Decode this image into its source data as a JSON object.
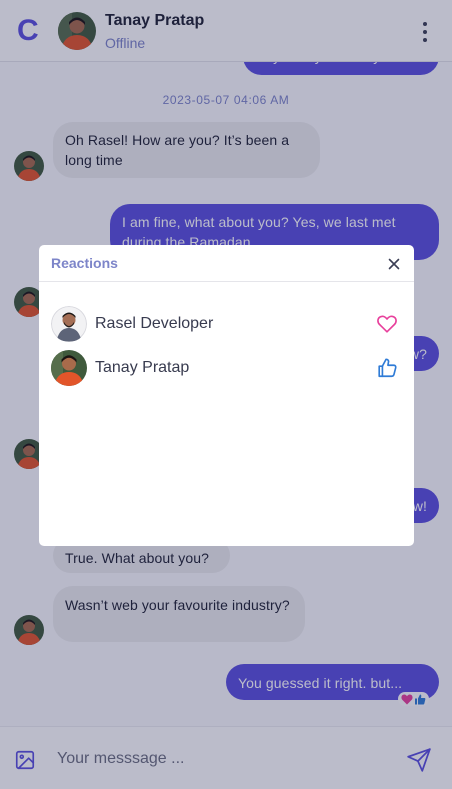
{
  "app": {
    "logo_letter": "C"
  },
  "header": {
    "contact_name": "Tanay Pratap",
    "status": "Offline",
    "menu_icon": "kebab-menu-icon"
  },
  "conversation": {
    "timestamp": "2023-05-07 04:06 AM",
    "messages": [
      {
        "direction": "out",
        "text": "Hey Tanay. All is it you?"
      },
      {
        "direction": "in",
        "text": "Oh Rasel! How are you? It’s been a long time"
      },
      {
        "direction": "out",
        "text": "I am fine, what about you? Yes, we last met during the Ramadan"
      },
      {
        "direction": "out",
        "text": "w?"
      },
      {
        "direction": "out",
        "text": "w!"
      },
      {
        "direction": "in",
        "text": "True. What about you?"
      },
      {
        "direction": "in",
        "text": "Wasn’t web your favourite industry?"
      },
      {
        "direction": "out",
        "text": "You guessed it right. but..."
      }
    ],
    "last_message_reactions": [
      "heart-icon",
      "thumbs-up-icon"
    ]
  },
  "composer": {
    "placeholder": "Your messsage ...",
    "value": ""
  },
  "reactions_modal": {
    "title": "Reactions",
    "items": [
      {
        "name": "Rasel Developer",
        "reaction": "heart-icon"
      },
      {
        "name": "Tanay Pratap",
        "reaction": "thumbs-up-icon"
      }
    ]
  },
  "colors": {
    "brand": "#5b50df",
    "muted_accent": "#7d85c9",
    "heart": "#e8409c",
    "like": "#2f7bd6",
    "incoming_bubble": "#ececee"
  }
}
